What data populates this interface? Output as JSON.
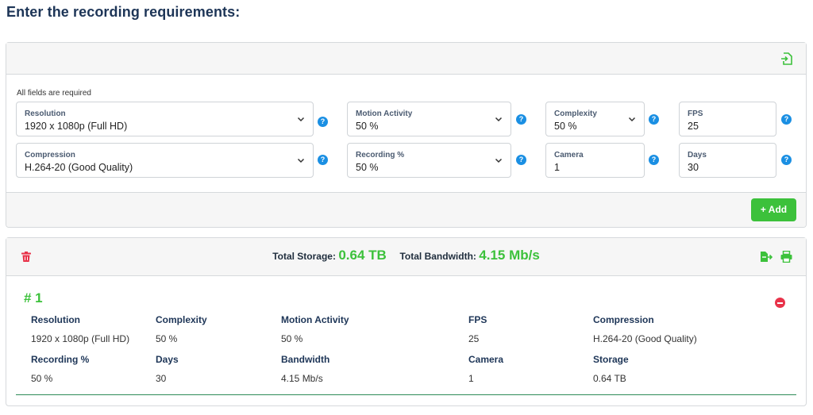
{
  "page": {
    "title": "Enter the recording requirements:"
  },
  "form": {
    "required_note": "All fields are required",
    "fields": {
      "resolution": {
        "label": "Resolution",
        "value": "1920 x 1080p (Full HD)"
      },
      "motion_activity": {
        "label": "Motion Activity",
        "value": "50 %"
      },
      "complexity": {
        "label": "Complexity",
        "value": "50 %"
      },
      "fps": {
        "label": "FPS",
        "value": "25"
      },
      "compression": {
        "label": "Compression",
        "value": "H.264-20 (Good Quality)"
      },
      "recording": {
        "label": "Recording %",
        "value": "50 %"
      },
      "camera": {
        "label": "Camera",
        "value": "1"
      },
      "days": {
        "label": "Days",
        "value": "30"
      }
    },
    "help_glyph": "?",
    "add_label": "+ Add"
  },
  "results": {
    "total_storage_label": "Total Storage:",
    "total_storage_value": "0.64 TB",
    "total_bandwidth_label": "Total Bandwidth:",
    "total_bandwidth_value": "4.15 Mb/s",
    "entries": [
      {
        "number": "# 1",
        "resolution": {
          "label": "Resolution",
          "value": "1920 x 1080p (Full HD)"
        },
        "complexity": {
          "label": "Complexity",
          "value": "50 %"
        },
        "motion_activity": {
          "label": "Motion Activity",
          "value": "50 %"
        },
        "fps": {
          "label": "FPS",
          "value": "25"
        },
        "compression": {
          "label": "Compression",
          "value": "H.264-20 (Good Quality)"
        },
        "recording": {
          "label": "Recording %",
          "value": "50 %"
        },
        "days": {
          "label": "Days",
          "value": "30"
        },
        "bandwidth": {
          "label": "Bandwidth",
          "value": "4.15 Mb/s"
        },
        "camera": {
          "label": "Camera",
          "value": "1"
        },
        "storage": {
          "label": "Storage",
          "value": "0.64 TB"
        }
      }
    ]
  },
  "colors": {
    "accent_green": "#3cc13b",
    "help_blue": "#1a8fe3",
    "danger_red": "#e8334a",
    "title_navy": "#1d3557"
  },
  "icons": [
    "file-import-icon",
    "help-icon",
    "chevron-down-icon",
    "trash-icon",
    "file-export-icon",
    "print-icon",
    "remove-icon"
  ]
}
